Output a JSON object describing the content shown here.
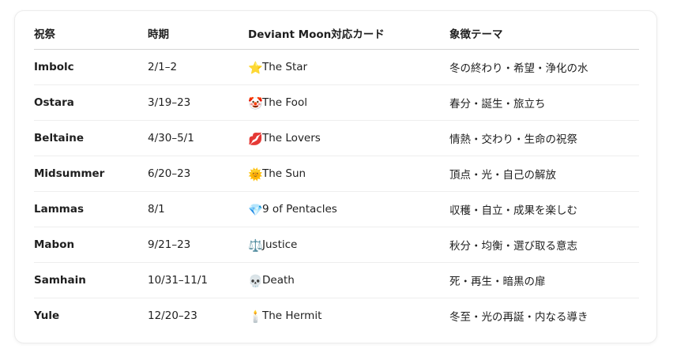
{
  "table": {
    "headers": [
      "祝祭",
      "時期",
      "Deviant Moon対応カード",
      "象徴テーマ"
    ],
    "rows": [
      {
        "festival": "Imbolc",
        "period": "2/1–2",
        "icon": "star-icon",
        "emoji": "⭐",
        "card": "The Star",
        "theme": "冬の終わり・希望・浄化の水"
      },
      {
        "festival": "Ostara",
        "period": "3/19–23",
        "icon": "clown-icon",
        "emoji": "🤡",
        "card": "The Fool",
        "theme": "春分・誕生・旅立ち"
      },
      {
        "festival": "Beltaine",
        "period": "4/30–5/1",
        "icon": "lips-icon",
        "emoji": "💋",
        "card": "The Lovers",
        "theme": "情熱・交わり・生命の祝祭"
      },
      {
        "festival": "Midsummer",
        "period": "6/20–23",
        "icon": "sun-face-icon",
        "emoji": "🌞",
        "card": "The Sun",
        "theme": "頂点・光・自己の解放"
      },
      {
        "festival": "Lammas",
        "period": "8/1",
        "icon": "gem-icon",
        "emoji": "💎",
        "card": "9 of Pentacles",
        "theme": "収穫・自立・成果を楽しむ"
      },
      {
        "festival": "Mabon",
        "period": "9/21–23",
        "icon": "scales-icon",
        "emoji": "⚖️",
        "card": "Justice",
        "theme": "秋分・均衡・選び取る意志"
      },
      {
        "festival": "Samhain",
        "period": "10/31–11/1",
        "icon": "skull-icon",
        "emoji": "💀",
        "card": "Death",
        "theme": "死・再生・暗黒の扉"
      },
      {
        "festival": "Yule",
        "period": "12/20–23",
        "icon": "candle-icon",
        "emoji": "🕯️",
        "card": "The Hermit",
        "theme": "冬至・光の再誕・内なる導き"
      }
    ]
  }
}
